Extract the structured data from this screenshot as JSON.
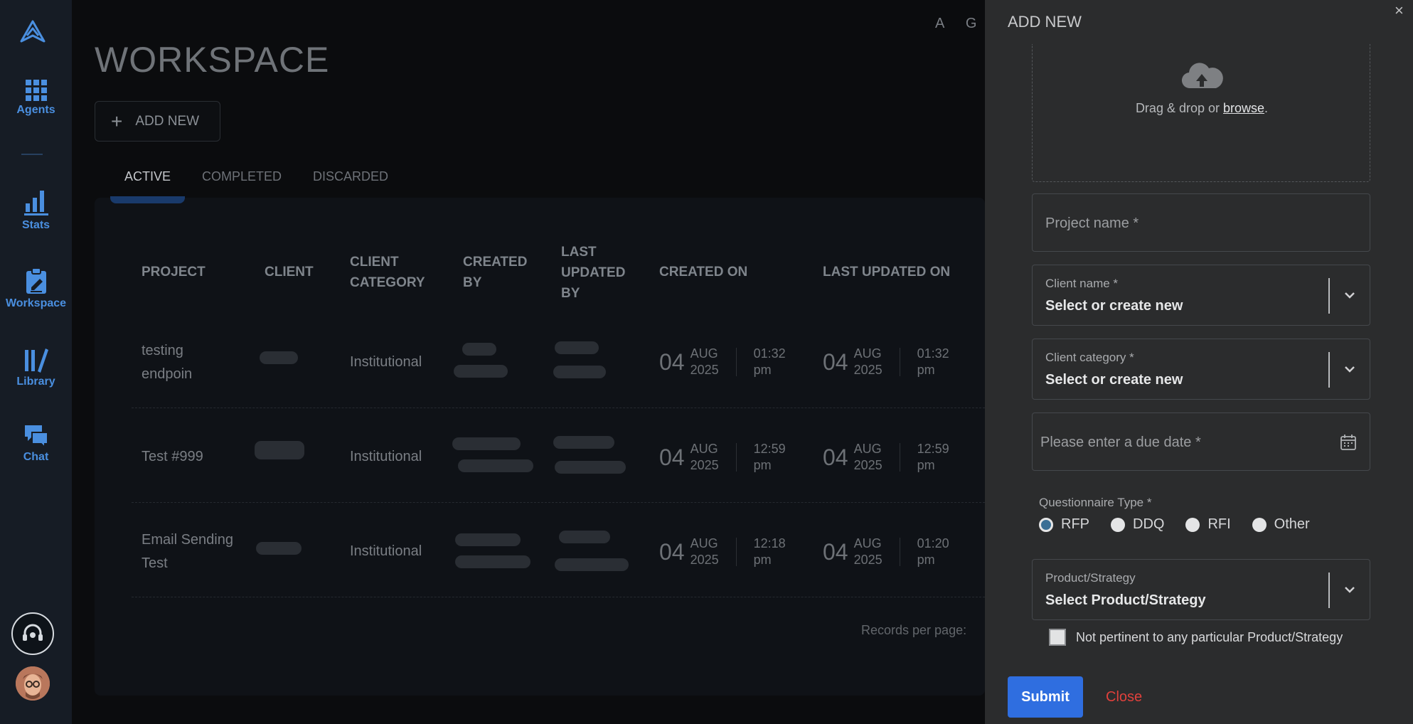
{
  "sidebar": {
    "items": [
      {
        "label": "Agents",
        "icon": "grid-icon"
      },
      {
        "label": "Stats",
        "icon": "bar-chart-icon"
      },
      {
        "label": "Workspace",
        "icon": "clipboard-icon"
      },
      {
        "label": "Library",
        "icon": "library-icon"
      },
      {
        "label": "Chat",
        "icon": "chat-icon"
      }
    ]
  },
  "header": {
    "title": "WORKSPACE",
    "top_letters": [
      "A",
      "G"
    ]
  },
  "workspace": {
    "add_label": "ADD NEW",
    "tabs": [
      "ACTIVE",
      "COMPLETED",
      "DISCARDED"
    ],
    "columns": [
      "PROJECT",
      "CLIENT",
      "CLIENT CATEGORY",
      "CREATED BY",
      "LAST UPDATED BY",
      "CREATED ON",
      "LAST UPDATED ON"
    ],
    "rows": [
      {
        "project": "testing endpoin",
        "category": "Institutional",
        "created": {
          "day": "04",
          "month": "AUG",
          "year": "2025",
          "time": "01:32",
          "ampm": "pm"
        },
        "updated": {
          "day": "04",
          "month": "AUG",
          "year": "2025",
          "time": "01:32",
          "ampm": "pm"
        }
      },
      {
        "project": "Test #999",
        "category": "Institutional",
        "created": {
          "day": "04",
          "month": "AUG",
          "year": "2025",
          "time": "12:59",
          "ampm": "pm"
        },
        "updated": {
          "day": "04",
          "month": "AUG",
          "year": "2025",
          "time": "12:59",
          "ampm": "pm"
        }
      },
      {
        "project": "Email Sending Test",
        "category": "Institutional",
        "created": {
          "day": "04",
          "month": "AUG",
          "year": "2025",
          "time": "12:18",
          "ampm": "pm"
        },
        "updated": {
          "day": "04",
          "month": "AUG",
          "year": "2025",
          "time": "01:20",
          "ampm": "pm"
        }
      }
    ],
    "records_label": "Records per page:"
  },
  "drawer": {
    "title": "ADD NEW",
    "close_symbol": "×",
    "dropzone": {
      "text": "Drag & drop or ",
      "link": "browse",
      "suffix": "."
    },
    "project_name_placeholder": "Project name *",
    "client_name": {
      "label": "Client name *",
      "value": "Select or create new"
    },
    "client_category": {
      "label": "Client category *",
      "value": "Select or create new"
    },
    "due_date_placeholder": "Please enter a due date *",
    "questionnaire": {
      "label": "Questionnaire Type *",
      "options": [
        "RFP",
        "DDQ",
        "RFI",
        "Other"
      ],
      "selected": "RFP"
    },
    "product": {
      "label": "Product/Strategy",
      "value": "Select Product/Strategy"
    },
    "not_pertinent_label": "Not pertinent to any particular Product/Strategy",
    "submit_label": "Submit",
    "close_label": "Close"
  },
  "colors": {
    "accent": "#2f6ee0",
    "sidebar_active": "#4a8fe0",
    "close_text": "#e0413c"
  }
}
